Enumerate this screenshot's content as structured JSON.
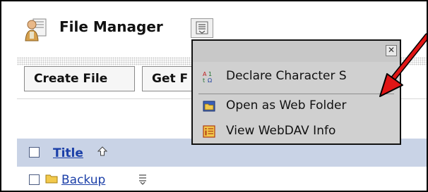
{
  "header": {
    "title": "File Manager",
    "icon": "file-manager-icon",
    "menu_toggle_icon": "menu-toggle-icon"
  },
  "toolbar": {
    "create_file_label": "Create File",
    "get_label": "Get F"
  },
  "list": {
    "header": {
      "title_label": "Title",
      "sort_icon": "sort-asc-icon"
    },
    "rows": [
      {
        "name": "Backup",
        "type": "folder"
      }
    ]
  },
  "popup": {
    "close_label": "✕",
    "items": [
      {
        "label": "Declare Character S",
        "icon": "charset-icon"
      },
      {
        "label": "Open as Web Folder",
        "icon": "web-folder-icon"
      },
      {
        "label": "View WebDAV Info",
        "icon": "info-icon"
      }
    ]
  },
  "annotation": {
    "arrow_color": "#e01515"
  },
  "colors": {
    "link": "#1b3fa8",
    "header_row_bg": "#c9d3e6",
    "popup_bg": "#d0d0d0"
  }
}
